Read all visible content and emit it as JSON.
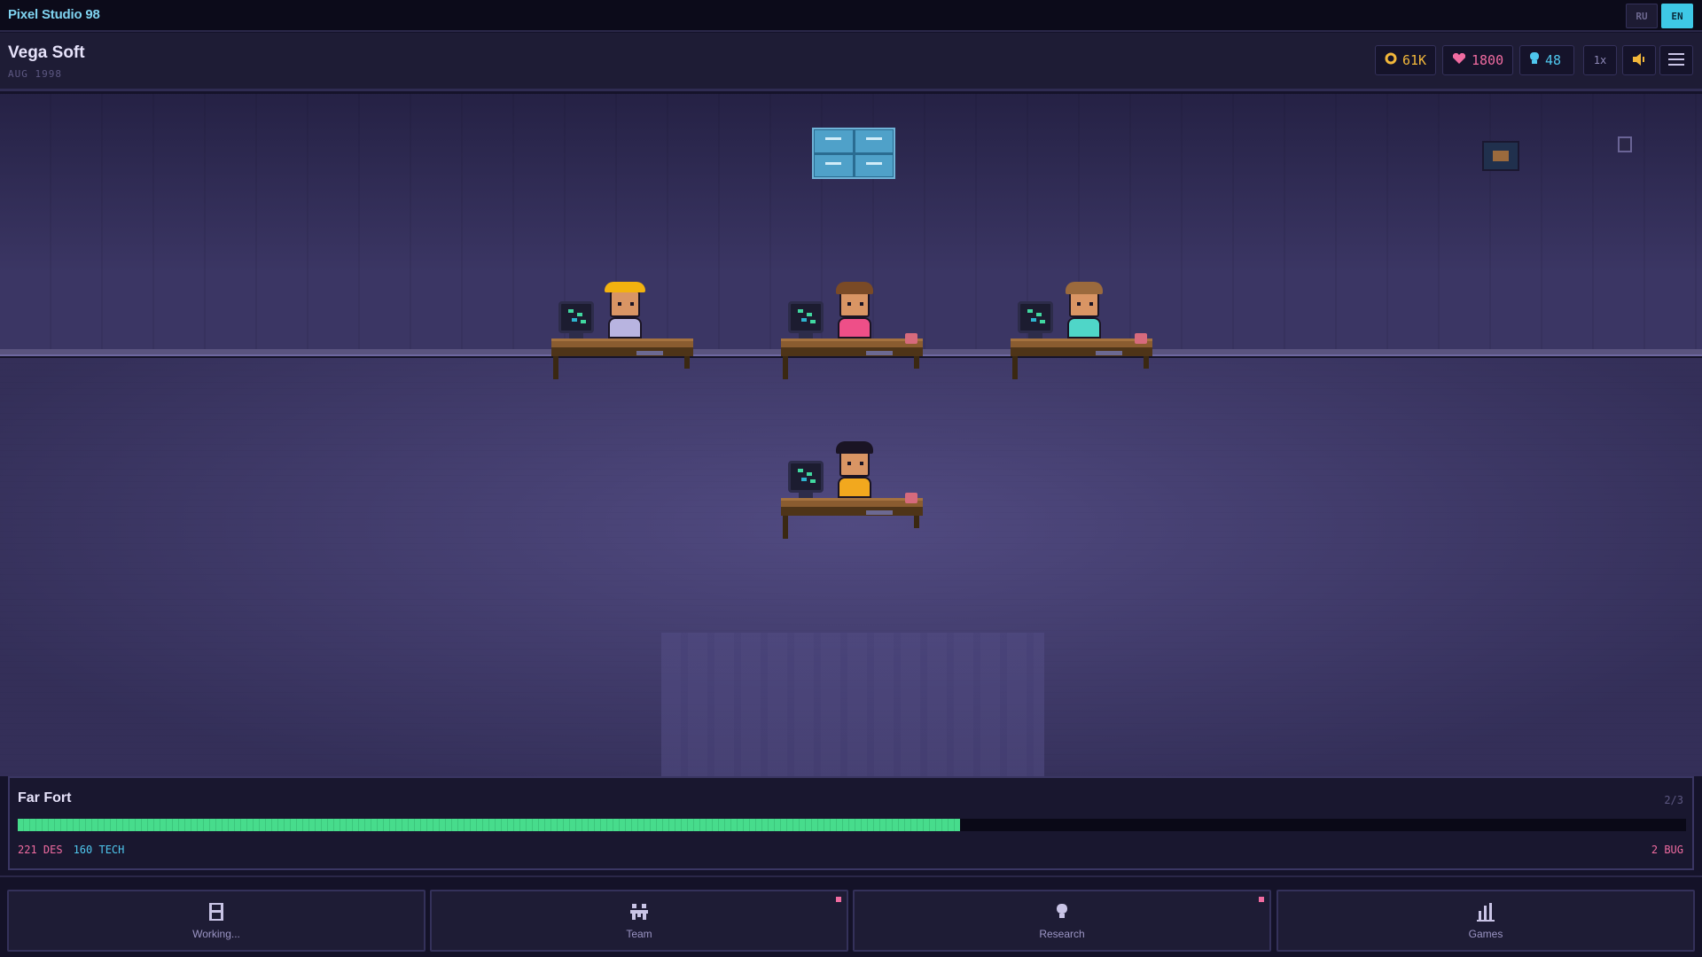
{
  "window": {
    "title": "Pixel Studio 98",
    "languages": [
      "RU",
      "EN"
    ],
    "active_language": "EN"
  },
  "studio": {
    "name": "Vega Soft",
    "date": "AUG 1998"
  },
  "stats": {
    "coins": "61K",
    "hearts": "1800",
    "ideas": "48",
    "coin_icon": "coin-icon",
    "heart_icon": "heart-icon",
    "idea_icon": "bulb-icon"
  },
  "controls": {
    "speed": "1x",
    "sound_icon": "speaker-icon",
    "menu_icon": "hamburger-menu-icon"
  },
  "colors": {
    "accent": "#3ec8e6",
    "progress": "#47dc8c",
    "design": "#f06ba0",
    "tech": "#4fc7ee",
    "coins": "#f2b73a"
  },
  "workers": [
    {
      "hair": "yellow-cap",
      "shirt": "#b8b4e0"
    },
    {
      "hair": "#7a4a26",
      "shirt": "#ee4f88"
    },
    {
      "hair": "#9b6a3d",
      "shirt": "#4fd6c8"
    },
    {
      "hair": "#1a1424",
      "shirt": "#f2a81e"
    }
  ],
  "project": {
    "name": "Far Fort",
    "phase": "2/3",
    "progress": 0.565,
    "design": "221 DES",
    "tech": "160 TECH",
    "bugs": "2 BUG"
  },
  "nav": [
    {
      "label": "Working...",
      "icon": "save-disk-icon",
      "notify": false
    },
    {
      "label": "Team",
      "icon": "team-icon",
      "notify": true
    },
    {
      "label": "Research",
      "icon": "bulb-icon",
      "notify": true
    },
    {
      "label": "Games",
      "icon": "bar-chart-icon",
      "notify": false
    }
  ]
}
